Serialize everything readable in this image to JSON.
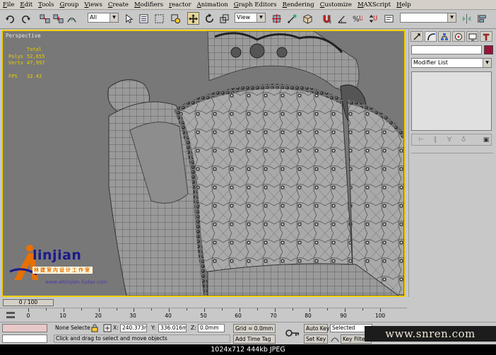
{
  "menu": [
    "File",
    "Edit",
    "Tools",
    "Group",
    "Views",
    "Create",
    "Modifiers",
    "reactor",
    "Animation",
    "Graph Editors",
    "Rendering",
    "Customize",
    "MAXScript",
    "Help"
  ],
  "toolbar": {
    "selection_filter": "All",
    "ref_coord": "View"
  },
  "viewport": {
    "label": "Perspective",
    "stats_header": "Total",
    "stats": [
      {
        "key": "Polys",
        "value": "52,655"
      },
      {
        "key": "Verts",
        "value": "47,997"
      },
      {
        "key": "FPS",
        "value": "32.43"
      }
    ],
    "logo_text": "linjian",
    "logo_sub": "林建室内设计工作室",
    "logo_url": "www.ahlinjian.fudao.com",
    "colors": {
      "border": "#f0d000",
      "bg": "#787878",
      "stats": "#e8d000"
    }
  },
  "command_panel": {
    "tabs": [
      "create-icon",
      "modify-icon",
      "hierarchy-icon",
      "motion-icon",
      "display-icon",
      "utilities-icon"
    ],
    "modifier_list": "Modifier List",
    "object_color": "#9a1238"
  },
  "timeline": {
    "slider": "0 / 100",
    "ticks": [
      "0",
      "10",
      "20",
      "30",
      "40",
      "50",
      "60",
      "70",
      "80",
      "90",
      "100"
    ]
  },
  "status": {
    "selection": "None Selecte",
    "x": "240.373mm",
    "y": "336.016mm",
    "z": "0.0mm",
    "grid": "Grid = 0.0mm",
    "prompt": "Click and drag to select and move objects",
    "add_time_tag": "Add Time Tag",
    "auto_key": "Auto Key",
    "set_key": "Set Key",
    "key_mode": "Selected",
    "key_filters": "Key Filte"
  },
  "watermark": "www.snren.com",
  "caption": "1024x712 444kb JPEG"
}
